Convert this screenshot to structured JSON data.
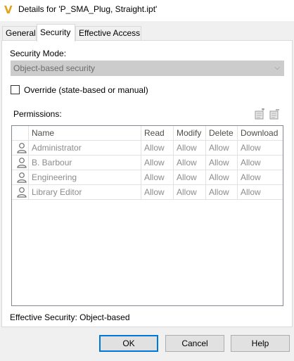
{
  "window": {
    "title": "Details for 'P_SMA_Plug, Straight.ipt'",
    "icon_glyph": "V"
  },
  "tabs": [
    {
      "label": "General",
      "active": false
    },
    {
      "label": "Security",
      "active": true
    },
    {
      "label": "Effective Access",
      "active": false
    }
  ],
  "security": {
    "mode_label": "Security Mode:",
    "mode_value": "Object-based security",
    "override_label": "Override (state-based or manual)",
    "override_checked": false,
    "permissions_label": "Permissions:",
    "toolbar_icons": [
      "add-permission-icon",
      "remove-permission-icon"
    ]
  },
  "permissions": {
    "columns": [
      "Name",
      "Read",
      "Modify",
      "Delete",
      "Download"
    ],
    "rows": [
      {
        "name": "Administrator",
        "read": "Allow",
        "modify": "Allow",
        "delete": "Allow",
        "download": "Allow"
      },
      {
        "name": "B. Barbour",
        "read": "Allow",
        "modify": "Allow",
        "delete": "Allow",
        "download": "Allow"
      },
      {
        "name": "Engineering",
        "read": "Allow",
        "modify": "Allow",
        "delete": "Allow",
        "download": "Allow"
      },
      {
        "name": "Library Editor",
        "read": "Allow",
        "modify": "Allow",
        "delete": "Allow",
        "download": "Allow"
      }
    ]
  },
  "status": {
    "effective_security": "Effective Security: Object-based"
  },
  "buttons": {
    "ok": "OK",
    "cancel": "Cancel",
    "help": "Help"
  },
  "colors": {
    "accent": "#0078d7",
    "app_icon": "#e2a31b",
    "disabled_text": "#8c8c8c"
  }
}
